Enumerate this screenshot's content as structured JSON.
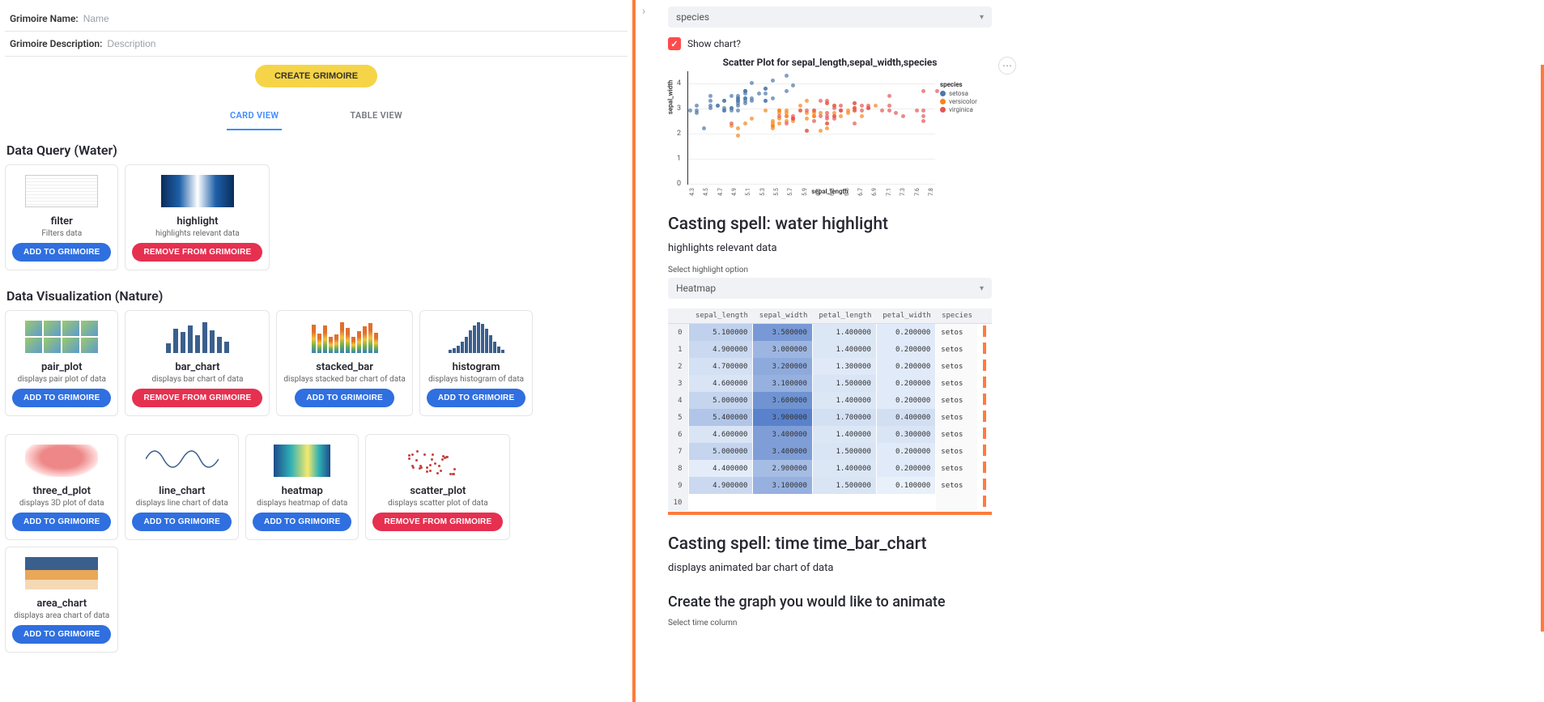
{
  "form": {
    "name_label": "Grimoire Name:",
    "name_placeholder": "Name",
    "desc_label": "Grimoire Description:",
    "desc_placeholder": "Description",
    "create_btn": "CREATE GRIMOIRE"
  },
  "tabs": {
    "card": "CARD VIEW",
    "table": "TABLE VIEW"
  },
  "buttons": {
    "add": "ADD TO GRIMOIRE",
    "remove": "REMOVE FROM GRIMOIRE"
  },
  "sections": {
    "water": {
      "title": "Data Query (Water)",
      "cards": [
        {
          "name": "filter",
          "desc": "Filters data",
          "action": "add",
          "thumb": "table"
        },
        {
          "name": "highlight",
          "desc": "highlights relevant data",
          "action": "remove",
          "thumb": "heat"
        }
      ]
    },
    "nature": {
      "title": "Data Visualization (Nature)",
      "rows": [
        [
          {
            "name": "pair_plot",
            "desc": "displays pair plot of data",
            "action": "add",
            "thumb": "pair"
          },
          {
            "name": "bar_chart",
            "desc": "displays bar chart of data",
            "action": "remove",
            "thumb": "bars"
          },
          {
            "name": "stacked_bar",
            "desc": "displays stacked bar chart of data",
            "action": "add",
            "thumb": "stacked"
          },
          {
            "name": "histogram",
            "desc": "displays histogram of data",
            "action": "add",
            "thumb": "hist"
          }
        ],
        [
          {
            "name": "three_d_plot",
            "desc": "displays 3D plot of data",
            "action": "add",
            "thumb": "3d"
          },
          {
            "name": "line_chart",
            "desc": "displays line chart of data",
            "action": "add",
            "thumb": "linewave"
          },
          {
            "name": "heatmap",
            "desc": "displays heatmap of data",
            "action": "add",
            "thumb": "heatmap2"
          },
          {
            "name": "scatter_plot",
            "desc": "displays scatter plot of data",
            "action": "remove",
            "thumb": "scatter2"
          },
          {
            "name": "area_chart",
            "desc": "displays area chart of data",
            "action": "add",
            "thumb": "area"
          }
        ]
      ]
    }
  },
  "right": {
    "species_select": "species",
    "show_chart_label": "Show chart?",
    "chart_title": "Scatter Plot for sepal_length,sepal_width,species",
    "legend_title": "species",
    "legend_items": [
      {
        "name": "setosa",
        "color": "#4c78a8"
      },
      {
        "name": "versicolor",
        "color": "#f58518"
      },
      {
        "name": "virginica",
        "color": "#e45756"
      }
    ],
    "ylabel": "sepal_width",
    "xlabel": "sepal_length",
    "yticks": [
      "0",
      "1",
      "2",
      "3",
      "4"
    ],
    "xticks": [
      "4.3",
      "4.5",
      "4.7",
      "4.9",
      "5.1",
      "5.3",
      "5.5",
      "5.7",
      "5.9",
      "6.1",
      "6.3",
      "6.5",
      "6.7",
      "6.9",
      "7.1",
      "7.3",
      "7.6",
      "7.8"
    ],
    "spell1_title": "Casting spell: water highlight",
    "spell1_sub": "highlights relevant data",
    "spell1_opt_label": "Select highlight option",
    "spell1_select": "Heatmap",
    "table_cols": [
      "sepal_length",
      "sepal_width",
      "petal_length",
      "petal_width",
      "species"
    ],
    "table_rows": [
      {
        "i": 0,
        "sl": "5.100000",
        "sw": "3.500000",
        "pl": "1.400000",
        "pw": "0.200000",
        "sp": "setos"
      },
      {
        "i": 1,
        "sl": "4.900000",
        "sw": "3.000000",
        "pl": "1.400000",
        "pw": "0.200000",
        "sp": "setos"
      },
      {
        "i": 2,
        "sl": "4.700000",
        "sw": "3.200000",
        "pl": "1.300000",
        "pw": "0.200000",
        "sp": "setos"
      },
      {
        "i": 3,
        "sl": "4.600000",
        "sw": "3.100000",
        "pl": "1.500000",
        "pw": "0.200000",
        "sp": "setos"
      },
      {
        "i": 4,
        "sl": "5.000000",
        "sw": "3.600000",
        "pl": "1.400000",
        "pw": "0.200000",
        "sp": "setos"
      },
      {
        "i": 5,
        "sl": "5.400000",
        "sw": "3.900000",
        "pl": "1.700000",
        "pw": "0.400000",
        "sp": "setos"
      },
      {
        "i": 6,
        "sl": "4.600000",
        "sw": "3.400000",
        "pl": "1.400000",
        "pw": "0.300000",
        "sp": "setos"
      },
      {
        "i": 7,
        "sl": "5.000000",
        "sw": "3.400000",
        "pl": "1.500000",
        "pw": "0.200000",
        "sp": "setos"
      },
      {
        "i": 8,
        "sl": "4.400000",
        "sw": "2.900000",
        "pl": "1.400000",
        "pw": "0.200000",
        "sp": "setos"
      },
      {
        "i": 9,
        "sl": "4.900000",
        "sw": "3.100000",
        "pl": "1.500000",
        "pw": "0.100000",
        "sp": "setos"
      },
      {
        "i": 10,
        "sl": "",
        "sw": "",
        "pl": "",
        "pw": "",
        "sp": ""
      }
    ],
    "spell2_title": "Casting spell: time time_bar_chart",
    "spell2_sub": "displays animated bar chart of data",
    "spell2_head2": "Create the graph you would like to animate",
    "spell2_opt_label": "Select time column"
  },
  "chart_data": {
    "type": "scatter",
    "title": "Scatter Plot for sepal_length,sepal_width,species",
    "xlabel": "sepal_length",
    "ylabel": "sepal_width",
    "xlim": [
      4.3,
      7.9
    ],
    "ylim": [
      0,
      4.5
    ],
    "series": [
      {
        "name": "setosa",
        "color": "#4c78a8",
        "points": [
          [
            5.1,
            3.5
          ],
          [
            4.9,
            3.0
          ],
          [
            4.7,
            3.2
          ],
          [
            4.6,
            3.1
          ],
          [
            5.0,
            3.6
          ],
          [
            5.4,
            3.9
          ],
          [
            4.6,
            3.4
          ],
          [
            5.0,
            3.4
          ],
          [
            4.4,
            2.9
          ],
          [
            4.9,
            3.1
          ],
          [
            5.4,
            3.7
          ],
          [
            4.8,
            3.4
          ],
          [
            4.8,
            3.0
          ],
          [
            4.3,
            3.0
          ],
          [
            5.8,
            4.0
          ],
          [
            5.7,
            4.4
          ],
          [
            5.4,
            3.9
          ],
          [
            5.1,
            3.5
          ],
          [
            5.7,
            3.8
          ],
          [
            5.1,
            3.8
          ],
          [
            5.4,
            3.4
          ],
          [
            5.1,
            3.7
          ],
          [
            4.6,
            3.6
          ],
          [
            5.1,
            3.3
          ],
          [
            4.8,
            3.4
          ],
          [
            5.0,
            3.0
          ],
          [
            5.0,
            3.4
          ],
          [
            5.2,
            3.5
          ],
          [
            5.2,
            3.4
          ],
          [
            4.7,
            3.2
          ],
          [
            4.8,
            3.1
          ],
          [
            5.4,
            3.4
          ],
          [
            5.2,
            4.1
          ],
          [
            5.5,
            4.2
          ],
          [
            4.9,
            3.1
          ],
          [
            5.0,
            3.2
          ],
          [
            5.5,
            3.5
          ],
          [
            4.9,
            3.6
          ],
          [
            4.4,
            3.0
          ],
          [
            5.1,
            3.4
          ],
          [
            5.0,
            3.5
          ],
          [
            4.5,
            2.3
          ],
          [
            4.4,
            3.2
          ],
          [
            5.0,
            3.5
          ],
          [
            5.1,
            3.8
          ],
          [
            4.8,
            3.0
          ],
          [
            5.1,
            3.8
          ],
          [
            4.6,
            3.2
          ],
          [
            5.3,
            3.7
          ],
          [
            5.0,
            3.3
          ]
        ]
      },
      {
        "name": "versicolor",
        "color": "#f58518",
        "points": [
          [
            7.0,
            3.2
          ],
          [
            6.4,
            3.2
          ],
          [
            6.9,
            3.1
          ],
          [
            5.5,
            2.3
          ],
          [
            6.5,
            2.8
          ],
          [
            5.7,
            2.8
          ],
          [
            6.3,
            3.3
          ],
          [
            4.9,
            2.4
          ],
          [
            6.6,
            2.9
          ],
          [
            5.2,
            2.7
          ],
          [
            5.0,
            2.0
          ],
          [
            5.9,
            3.0
          ],
          [
            6.0,
            2.2
          ],
          [
            6.1,
            2.9
          ],
          [
            5.6,
            2.9
          ],
          [
            6.7,
            3.1
          ],
          [
            5.6,
            3.0
          ],
          [
            5.8,
            2.7
          ],
          [
            6.2,
            2.2
          ],
          [
            5.6,
            2.5
          ],
          [
            5.9,
            3.2
          ],
          [
            6.1,
            2.8
          ],
          [
            6.3,
            2.5
          ],
          [
            6.1,
            2.8
          ],
          [
            6.4,
            2.9
          ],
          [
            6.6,
            3.0
          ],
          [
            6.8,
            2.8
          ],
          [
            6.7,
            3.0
          ],
          [
            6.0,
            2.9
          ],
          [
            5.7,
            2.6
          ],
          [
            5.5,
            2.4
          ],
          [
            5.5,
            2.4
          ],
          [
            5.8,
            2.7
          ],
          [
            6.0,
            2.7
          ],
          [
            5.4,
            3.0
          ],
          [
            6.0,
            3.4
          ],
          [
            6.7,
            3.1
          ],
          [
            6.3,
            2.3
          ],
          [
            5.6,
            3.0
          ],
          [
            5.5,
            2.5
          ],
          [
            5.5,
            2.6
          ],
          [
            6.1,
            3.0
          ],
          [
            5.8,
            2.6
          ],
          [
            5.0,
            2.3
          ],
          [
            5.6,
            2.7
          ],
          [
            5.7,
            3.0
          ],
          [
            5.7,
            2.9
          ],
          [
            6.2,
            2.9
          ],
          [
            5.1,
            2.5
          ],
          [
            5.7,
            2.8
          ]
        ]
      },
      {
        "name": "virginica",
        "color": "#e45756",
        "points": [
          [
            6.3,
            3.3
          ],
          [
            5.8,
            2.7
          ],
          [
            7.1,
            3.0
          ],
          [
            6.3,
            2.9
          ],
          [
            6.5,
            3.0
          ],
          [
            7.6,
            3.0
          ],
          [
            4.9,
            2.5
          ],
          [
            7.3,
            2.9
          ],
          [
            6.7,
            2.5
          ],
          [
            7.2,
            3.6
          ],
          [
            6.5,
            3.2
          ],
          [
            6.4,
            2.7
          ],
          [
            6.8,
            3.0
          ],
          [
            5.7,
            2.5
          ],
          [
            5.8,
            2.8
          ],
          [
            6.4,
            3.2
          ],
          [
            6.5,
            3.0
          ],
          [
            7.7,
            3.8
          ],
          [
            7.7,
            2.6
          ],
          [
            6.0,
            2.2
          ],
          [
            6.9,
            3.2
          ],
          [
            5.6,
            2.8
          ],
          [
            7.7,
            2.8
          ],
          [
            6.3,
            2.7
          ],
          [
            6.7,
            3.3
          ],
          [
            7.2,
            3.2
          ],
          [
            6.2,
            2.8
          ],
          [
            6.1,
            3.0
          ],
          [
            6.4,
            2.8
          ],
          [
            7.2,
            3.0
          ],
          [
            7.4,
            2.8
          ],
          [
            7.9,
            3.8
          ],
          [
            6.4,
            2.8
          ],
          [
            6.3,
            2.8
          ],
          [
            6.1,
            2.6
          ],
          [
            7.7,
            3.0
          ],
          [
            6.3,
            3.4
          ],
          [
            6.4,
            3.1
          ],
          [
            6.0,
            3.0
          ],
          [
            6.9,
            3.1
          ],
          [
            6.7,
            3.1
          ],
          [
            6.9,
            3.1
          ],
          [
            5.8,
            2.7
          ],
          [
            6.8,
            3.2
          ],
          [
            6.7,
            3.3
          ],
          [
            6.7,
            3.0
          ],
          [
            6.3,
            2.5
          ],
          [
            6.5,
            3.0
          ],
          [
            6.2,
            3.4
          ],
          [
            5.9,
            3.0
          ]
        ]
      }
    ]
  },
  "heat_scale": {
    "sl": {
      "min": 4.3,
      "max": 7.9
    },
    "sw": {
      "min": 2.0,
      "max": 4.4
    },
    "pl": {
      "min": 1.0,
      "max": 6.9
    },
    "pw": {
      "min": 0.1,
      "max": 2.5
    }
  }
}
